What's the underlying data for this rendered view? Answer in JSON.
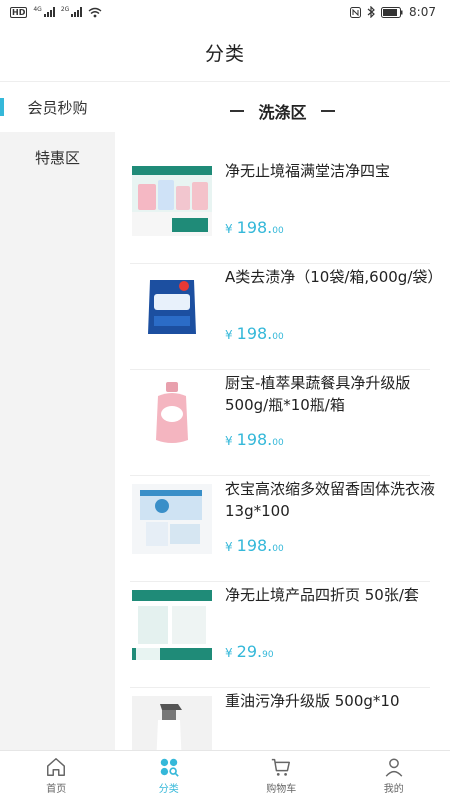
{
  "status_bar": {
    "hd": "HD",
    "net1": "4G",
    "net2": "2G",
    "time": "8:07"
  },
  "header": {
    "title": "分类"
  },
  "sidebar": {
    "items": [
      {
        "label": "会员秒购",
        "active": true
      },
      {
        "label": "特惠区",
        "active": false
      }
    ]
  },
  "section": {
    "title": "洗涤区"
  },
  "products": [
    {
      "name": "净无止境福满堂洁净四宝",
      "price_yen": "¥",
      "price_int": "198.",
      "price_cents": "00",
      "thumb": "gift-box-image"
    },
    {
      "name": "A类去渍净（10袋/箱,600g/袋）",
      "price_yen": "¥",
      "price_int": "198.",
      "price_cents": "00",
      "thumb": "detergent-bag-image"
    },
    {
      "name": "厨宝-植萃果蔬餐具净升级版500g/瓶*10瓶/箱",
      "price_yen": "¥",
      "price_int": "198.",
      "price_cents": "00",
      "thumb": "pink-bottle-image"
    },
    {
      "name": "衣宝高浓缩多效留香固体洗衣液 13g*100",
      "price_yen": "¥",
      "price_int": "198.",
      "price_cents": "00",
      "thumb": "laundry-box-image"
    },
    {
      "name": "净无止境产品四折页  50张/套",
      "price_yen": "¥",
      "price_int": "29.",
      "price_cents": "90",
      "thumb": "brochure-image"
    },
    {
      "name": "重油污净升级版 500g*10",
      "price_yen": "",
      "price_int": "",
      "price_cents": "",
      "thumb": "spray-bottle-image"
    }
  ],
  "tabbar": {
    "items": [
      {
        "label": "首页",
        "icon": "home-icon",
        "active": false
      },
      {
        "label": "分类",
        "icon": "category-icon",
        "active": true
      },
      {
        "label": "购物车",
        "icon": "cart-icon",
        "active": false
      },
      {
        "label": "我的",
        "icon": "user-icon",
        "active": false
      }
    ]
  },
  "colors": {
    "accent": "#35b8d9",
    "sidebar_bg": "#f3f3f3"
  }
}
